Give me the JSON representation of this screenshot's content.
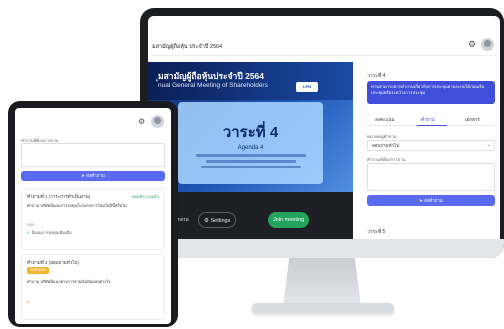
{
  "monitor": {
    "header": {
      "title": "มสามัญผู้ถือหุ้น ประจำปี 2564"
    },
    "slide": {
      "title_line1": "ุมสามัญผู้ถือหุ้นประจำปี 2564",
      "title_line2": "nual General Meeting of Shareholders",
      "logo_text": "LPN",
      "agenda_big": "วาระที่ 4",
      "agenda_small": "Agenda 4"
    },
    "controls": {
      "camera_label": "No camera",
      "settings_label": "Settings",
      "join_label": "Join meeting"
    },
    "panel": {
      "section_title": "วาระที่ 4",
      "notice": "ท่านสามารถฝากคำถามเกี่ยวกับการประชุมผ่านระบบได้ก่อนเริ่มประชุมหรือระหว่างการประชุม",
      "tabs": [
        "ลงคะแนน",
        "คำถาม",
        "เอกสาร"
      ],
      "select_label": "หมวดหมู่คำถาม",
      "select_value": "สอบถามทั่วไป",
      "textarea_label": "คำถามที่ต้องการถาม",
      "send_label": "ส่งคำถาม",
      "section2_title": "วาระที่ 5"
    }
  },
  "tablet": {
    "question_label": "คำถามที่ต้องการถาม",
    "send_label": "ส่งคำถาม",
    "questions": [
      {
        "title": "คำถามที่ 1 (วาระการดำเนินงาน)",
        "status": "ตอบคำถามแล้ว",
        "body": "คำถาม บริษัทมีแผนการลงทุนในโครงการใหม่ในปีนี้หรือไม่",
        "answer_label": "ตอบ",
        "answer": "มีแผนการลงทุนเพิ่มเติม",
        "badge": ""
      },
      {
        "title": "คำถามที่ 2 (สอบถามทั่วไป)",
        "status": "",
        "body": "คำถาม บริษัทมีแนวทางการจ่ายเงินปันผลอย่างไร",
        "answer_label": "",
        "answer": "",
        "badge": "รอคำตอบ"
      }
    ]
  },
  "colors": {
    "accent": "#3f4fd9",
    "button": "#5b6bf0",
    "success": "#22a45d",
    "badge": "#f3b234"
  },
  "icons": [
    "gear-icon",
    "avatar",
    "send-icon",
    "camera-off-icon",
    "settings-icon",
    "chevron-down-icon"
  ]
}
